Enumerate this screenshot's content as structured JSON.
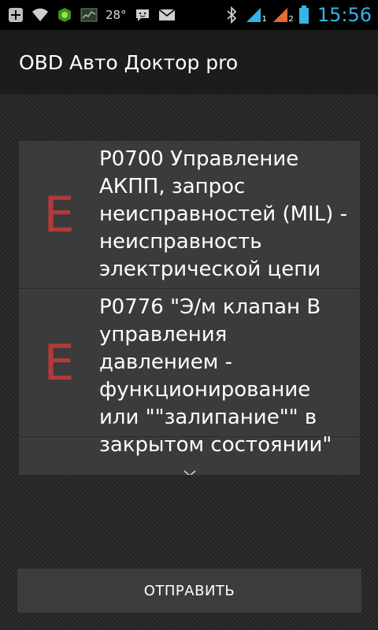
{
  "status_bar": {
    "temperature": "28°",
    "clock": "15:56",
    "sim_badge_1": "1",
    "sim_badge_2": "2",
    "icons": [
      "plus-icon",
      "wifi-icon",
      "android-icon",
      "chart-icon",
      "chat-icon",
      "mail-icon",
      "bluetooth-icon",
      "signal-icon",
      "battery-icon"
    ]
  },
  "app_bar": {
    "title": "OBD Авто Доктор pro"
  },
  "codes": [
    {
      "status": "E",
      "text": "P0700  Управление АКПП, запрос неисправностей (MIL) - неисправность электрической цепи"
    },
    {
      "status": "E",
      "text": "P0776  \"Э/м клапан В управления давлением - функционирование или \"\"залипание\"\" в закрытом состоянии\""
    }
  ],
  "send_button": {
    "label": "ОТПРАВИТЬ"
  },
  "colors": {
    "accent": "#33b5e5",
    "error": "#b33a3a",
    "background": "#2a2a2a"
  }
}
